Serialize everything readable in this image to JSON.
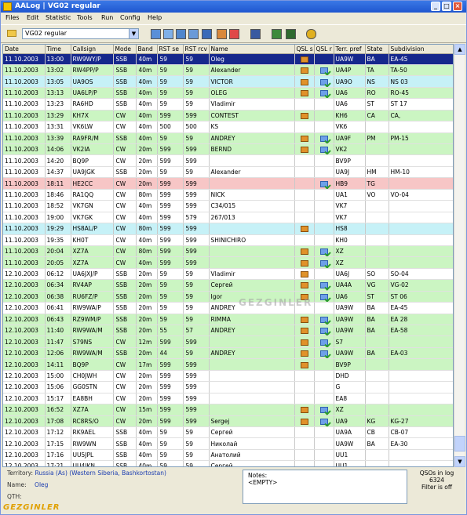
{
  "window": {
    "title": "AALog | VG02 regular",
    "minimize": "_",
    "maximize": "□",
    "close": "×"
  },
  "menu": [
    "Files",
    "Edit",
    "Statistic",
    "Tools",
    "Run",
    "Config",
    "Help"
  ],
  "toolbar": {
    "log_name": "VG02 regular"
  },
  "columns": [
    "Date",
    "Time",
    "Callsign",
    "Mode",
    "Band",
    "RST se",
    "RST rcv",
    "Name",
    "QSL s",
    "QSL r",
    "Terr. pref",
    "State",
    "Subdivision"
  ],
  "rows": [
    {
      "style": "sel",
      "date": "11.10.2003",
      "time": "13:00",
      "call": "RW9WY/P",
      "mode": "SSB",
      "band": "40m",
      "rsts": "59",
      "rstr": "59",
      "name": "Oleg",
      "qsls": true,
      "qslr": false,
      "pref": "UA9W",
      "state": "BA",
      "subdiv": "EA-45"
    },
    {
      "style": "green",
      "date": "11.10.2003",
      "time": "13:02",
      "call": "RW4PP/P",
      "mode": "SSB",
      "band": "40m",
      "rsts": "59",
      "rstr": "59",
      "name": "Alexander",
      "qsls": true,
      "qslr": true,
      "pref": "UA4P",
      "state": "TA",
      "subdiv": "TA-50"
    },
    {
      "style": "cyan",
      "date": "11.10.2003",
      "time": "13:05",
      "call": "UA9OS",
      "mode": "SSB",
      "band": "40m",
      "rsts": "59",
      "rstr": "59",
      "name": "VICTOR",
      "qsls": true,
      "qslr": true,
      "pref": "UA9O",
      "state": "NS",
      "subdiv": "NS 03"
    },
    {
      "style": "green",
      "date": "11.10.2003",
      "time": "13:13",
      "call": "UA6LP/P",
      "mode": "SSB",
      "band": "40m",
      "rsts": "59",
      "rstr": "59",
      "name": "OLEG",
      "qsls": true,
      "qslr": true,
      "pref": "UA6",
      "state": "RO",
      "subdiv": "RO-45"
    },
    {
      "style": "white",
      "date": "11.10.2003",
      "time": "13:23",
      "call": "RA6HD",
      "mode": "SSB",
      "band": "40m",
      "rsts": "59",
      "rstr": "59",
      "name": "Vladimir",
      "qsls": false,
      "qslr": false,
      "pref": "UA6",
      "state": "ST",
      "subdiv": "ST 17"
    },
    {
      "style": "green",
      "date": "11.10.2003",
      "time": "13:29",
      "call": "KH7X",
      "mode": "CW",
      "band": "40m",
      "rsts": "599",
      "rstr": "599",
      "name": "CONTEST",
      "qsls": true,
      "qslr": false,
      "pref": "KH6",
      "state": "CA",
      "subdiv": "CA,"
    },
    {
      "style": "white",
      "date": "11.10.2003",
      "time": "13:31",
      "call": "VK6LW",
      "mode": "CW",
      "band": "40m",
      "rsts": "500",
      "rstr": "500",
      "name": "KS",
      "qsls": false,
      "qslr": false,
      "pref": "VK6",
      "state": "",
      "subdiv": ""
    },
    {
      "style": "green",
      "date": "11.10.2003",
      "time": "13:39",
      "call": "RA9FR/M",
      "mode": "SSB",
      "band": "40m",
      "rsts": "59",
      "rstr": "59",
      "name": "ANDREY",
      "qsls": true,
      "qslr": true,
      "pref": "UA9F",
      "state": "PM",
      "subdiv": "PM-15"
    },
    {
      "style": "green",
      "date": "11.10.2003",
      "time": "14:06",
      "call": "VK2IA",
      "mode": "CW",
      "band": "20m",
      "rsts": "599",
      "rstr": "599",
      "name": "BERND",
      "qsls": true,
      "qslr": true,
      "pref": "VK2",
      "state": "",
      "subdiv": ""
    },
    {
      "style": "white",
      "date": "11.10.2003",
      "time": "14:20",
      "call": "BQ9P",
      "mode": "CW",
      "band": "20m",
      "rsts": "599",
      "rstr": "599",
      "name": "",
      "qsls": false,
      "qslr": false,
      "pref": "BV9P",
      "state": "",
      "subdiv": ""
    },
    {
      "style": "white",
      "date": "11.10.2003",
      "time": "14:37",
      "call": "UA9JGK",
      "mode": "SSB",
      "band": "20m",
      "rsts": "59",
      "rstr": "59",
      "name": "Alexander",
      "qsls": false,
      "qslr": false,
      "pref": "UA9J",
      "state": "HM",
      "subdiv": "HM-10"
    },
    {
      "style": "pink",
      "date": "11.10.2003",
      "time": "18:11",
      "call": "HE2CC",
      "mode": "CW",
      "band": "20m",
      "rsts": "599",
      "rstr": "599",
      "name": "",
      "qsls": false,
      "qslr": true,
      "pref": "HB9",
      "state": "TG",
      "subdiv": ""
    },
    {
      "style": "white",
      "date": "11.10.2003",
      "time": "18:46",
      "call": "RA1QQ",
      "mode": "CW",
      "band": "80m",
      "rsts": "599",
      "rstr": "599",
      "name": "NICK",
      "qsls": false,
      "qslr": false,
      "pref": "UA1",
      "state": "VO",
      "subdiv": "VO-04"
    },
    {
      "style": "white",
      "date": "11.10.2003",
      "time": "18:52",
      "call": "VK7GN",
      "mode": "CW",
      "band": "40m",
      "rsts": "599",
      "rstr": "599",
      "name": "C34/015",
      "qsls": false,
      "qslr": false,
      "pref": "VK7",
      "state": "",
      "subdiv": ""
    },
    {
      "style": "white",
      "date": "11.10.2003",
      "time": "19:00",
      "call": "VK7GK",
      "mode": "CW",
      "band": "40m",
      "rsts": "599",
      "rstr": "579",
      "name": "267/013",
      "qsls": false,
      "qslr": false,
      "pref": "VK7",
      "state": "",
      "subdiv": ""
    },
    {
      "style": "cyan",
      "date": "11.10.2003",
      "time": "19:29",
      "call": "HS8AL/P",
      "mode": "CW",
      "band": "80m",
      "rsts": "599",
      "rstr": "599",
      "name": "",
      "qsls": true,
      "qslr": false,
      "pref": "HS8",
      "state": "",
      "subdiv": ""
    },
    {
      "style": "white",
      "date": "11.10.2003",
      "time": "19:35",
      "call": "KH0T",
      "mode": "CW",
      "band": "40m",
      "rsts": "599",
      "rstr": "599",
      "name": "SHINICHIRO",
      "qsls": false,
      "qslr": false,
      "pref": "KH0",
      "state": "",
      "subdiv": ""
    },
    {
      "style": "green",
      "date": "11.10.2003",
      "time": "20:04",
      "call": "XZ7A",
      "mode": "CW",
      "band": "80m",
      "rsts": "599",
      "rstr": "599",
      "name": "",
      "qsls": true,
      "qslr": true,
      "pref": "XZ",
      "state": "",
      "subdiv": ""
    },
    {
      "style": "green",
      "date": "11.10.2003",
      "time": "20:05",
      "call": "XZ7A",
      "mode": "CW",
      "band": "40m",
      "rsts": "599",
      "rstr": "599",
      "name": "",
      "qsls": true,
      "qslr": true,
      "pref": "XZ",
      "state": "",
      "subdiv": ""
    },
    {
      "style": "white",
      "date": "12.10.2003",
      "time": "06:12",
      "call": "UA6JXJ/P",
      "mode": "SSB",
      "band": "20m",
      "rsts": "59",
      "rstr": "59",
      "name": "Vladimir",
      "qsls": true,
      "qslr": false,
      "pref": "UA6J",
      "state": "SO",
      "subdiv": "SO-04"
    },
    {
      "style": "green",
      "date": "12.10.2003",
      "time": "06:34",
      "call": "RV4AP",
      "mode": "SSB",
      "band": "20m",
      "rsts": "59",
      "rstr": "59",
      "name": "Сергей",
      "qsls": true,
      "qslr": true,
      "pref": "UA4A",
      "state": "VG",
      "subdiv": "VG-02"
    },
    {
      "style": "green",
      "date": "12.10.2003",
      "time": "06:38",
      "call": "RU6FZ/P",
      "mode": "SSB",
      "band": "20m",
      "rsts": "59",
      "rstr": "59",
      "name": "Igor",
      "qsls": true,
      "qslr": true,
      "pref": "UA6",
      "state": "ST",
      "subdiv": "ST 06"
    },
    {
      "style": "white",
      "date": "12.10.2003",
      "time": "06:41",
      "call": "RW9WA/P",
      "mode": "SSB",
      "band": "20m",
      "rsts": "59",
      "rstr": "59",
      "name": "ANDREY",
      "qsls": false,
      "qslr": false,
      "pref": "UA9W",
      "state": "BA",
      "subdiv": "EA-45"
    },
    {
      "style": "green",
      "date": "12.10.2003",
      "time": "06:43",
      "call": "RZ9WM/P",
      "mode": "SSB",
      "band": "20m",
      "rsts": "59",
      "rstr": "59",
      "name": "RIMMA",
      "qsls": true,
      "qslr": true,
      "pref": "UA9W",
      "state": "BA",
      "subdiv": "EA 28"
    },
    {
      "style": "green",
      "date": "12.10.2003",
      "time": "11:40",
      "call": "RW9WA/M",
      "mode": "SSB",
      "band": "20m",
      "rsts": "55",
      "rstr": "57",
      "name": "ANDREY",
      "qsls": true,
      "qslr": true,
      "pref": "UA9W",
      "state": "BA",
      "subdiv": "EA-58"
    },
    {
      "style": "green",
      "date": "12.10.2003",
      "time": "11:47",
      "call": "S79NS",
      "mode": "CW",
      "band": "12m",
      "rsts": "599",
      "rstr": "599",
      "name": "",
      "qsls": true,
      "qslr": true,
      "pref": "S7",
      "state": "",
      "subdiv": ""
    },
    {
      "style": "green",
      "date": "12.10.2003",
      "time": "12:06",
      "call": "RW9WA/M",
      "mode": "SSB",
      "band": "20m",
      "rsts": "44",
      "rstr": "59",
      "name": "ANDREY",
      "qsls": true,
      "qslr": true,
      "pref": "UA9W",
      "state": "BA",
      "subdiv": "EA-03"
    },
    {
      "style": "green",
      "date": "12.10.2003",
      "time": "14:11",
      "call": "BQ9P",
      "mode": "CW",
      "band": "17m",
      "rsts": "599",
      "rstr": "599",
      "name": "",
      "qsls": true,
      "qslr": false,
      "pref": "BV9P",
      "state": "",
      "subdiv": ""
    },
    {
      "style": "white",
      "date": "12.10.2003",
      "time": "15:00",
      "call": "CH0JWH",
      "mode": "CW",
      "band": "20m",
      "rsts": "599",
      "rstr": "599",
      "name": "",
      "qsls": false,
      "qslr": false,
      "pref": "DHD",
      "state": "",
      "subdiv": ""
    },
    {
      "style": "white",
      "date": "12.10.2003",
      "time": "15:06",
      "call": "GG0STN",
      "mode": "CW",
      "band": "20m",
      "rsts": "599",
      "rstr": "599",
      "name": "",
      "qsls": false,
      "qslr": false,
      "pref": "G",
      "state": "",
      "subdiv": ""
    },
    {
      "style": "white",
      "date": "12.10.2003",
      "time": "15:17",
      "call": "EA8BH",
      "mode": "CW",
      "band": "20m",
      "rsts": "599",
      "rstr": "599",
      "name": "",
      "qsls": false,
      "qslr": false,
      "pref": "EA8",
      "state": "",
      "subdiv": ""
    },
    {
      "style": "green",
      "date": "12.10.2003",
      "time": "16:52",
      "call": "XZ7A",
      "mode": "CW",
      "band": "15m",
      "rsts": "599",
      "rstr": "599",
      "name": "",
      "qsls": true,
      "qslr": true,
      "pref": "XZ",
      "state": "",
      "subdiv": ""
    },
    {
      "style": "green",
      "date": "12.10.2003",
      "time": "17:08",
      "call": "RC8RS/O",
      "mode": "CW",
      "band": "20m",
      "rsts": "599",
      "rstr": "599",
      "name": "Sergej",
      "qsls": true,
      "qslr": true,
      "pref": "UA9",
      "state": "KG",
      "subdiv": "KG-27"
    },
    {
      "style": "white",
      "date": "12.10.2003",
      "time": "17:12",
      "call": "RK9AEL",
      "mode": "SSB",
      "band": "40m",
      "rsts": "59",
      "rstr": "59",
      "name": "Сергей",
      "qsls": false,
      "qslr": false,
      "pref": "UA9A",
      "state": "CB",
      "subdiv": "CB-07"
    },
    {
      "style": "white",
      "date": "12.10.2003",
      "time": "17:15",
      "call": "RW9WN",
      "mode": "SSB",
      "band": "40m",
      "rsts": "59",
      "rstr": "59",
      "name": "Николай",
      "qsls": false,
      "qslr": false,
      "pref": "UA9W",
      "state": "BA",
      "subdiv": "EA-30"
    },
    {
      "style": "white",
      "date": "12.10.2003",
      "time": "17:16",
      "call": "UU5JPL",
      "mode": "SSB",
      "band": "40m",
      "rsts": "59",
      "rstr": "59",
      "name": "Анатолий",
      "qsls": false,
      "qslr": false,
      "pref": "UU1",
      "state": "",
      "subdiv": ""
    },
    {
      "style": "white",
      "date": "12.10.2003",
      "time": "17:21",
      "call": "UU4JKN",
      "mode": "SSB",
      "band": "40m",
      "rsts": "59",
      "rstr": "59",
      "name": "Сергей",
      "qsls": false,
      "qslr": false,
      "pref": "UU1",
      "state": "",
      "subdiv": ""
    }
  ],
  "status": {
    "territory_label": "Territory:",
    "territory_value": "Russia (As) (Western Siberia, Bashkortostan)",
    "name_label": "Name:",
    "name_value": "Oleg",
    "qth_label": "QTH:",
    "notes_label": "Notes:",
    "notes_value": "<EMPTY>",
    "qso_label": "QSOs in log",
    "qso_count": "6324",
    "filter_state": "Filter is off"
  },
  "watermark": "GEZGINLER",
  "grid_watermark": "GEZGINLER",
  "colors": {
    "selected": "#16288c",
    "green": "#cbf5c2",
    "cyan": "#c6f1f7",
    "pink": "#f7c6c6",
    "title": "#1f56cf"
  }
}
